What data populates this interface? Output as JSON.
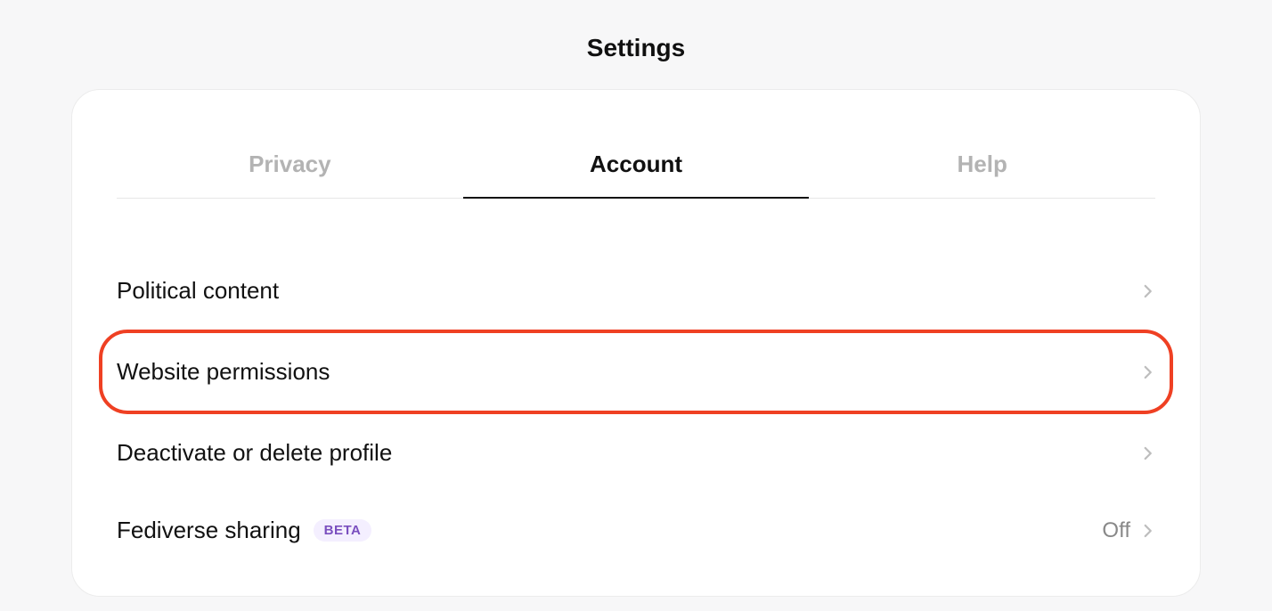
{
  "header": {
    "title": "Settings"
  },
  "tabs": [
    {
      "label": "Privacy",
      "active": false
    },
    {
      "label": "Account",
      "active": true
    },
    {
      "label": "Help",
      "active": false
    }
  ],
  "rows": [
    {
      "label": "Political content",
      "value": "",
      "badge": "",
      "highlight": false
    },
    {
      "label": "Website permissions",
      "value": "",
      "badge": "",
      "highlight": true
    },
    {
      "label": "Deactivate or delete profile",
      "value": "",
      "badge": "",
      "highlight": false
    },
    {
      "label": "Fediverse sharing",
      "value": "Off",
      "badge": "BETA",
      "highlight": false
    }
  ]
}
